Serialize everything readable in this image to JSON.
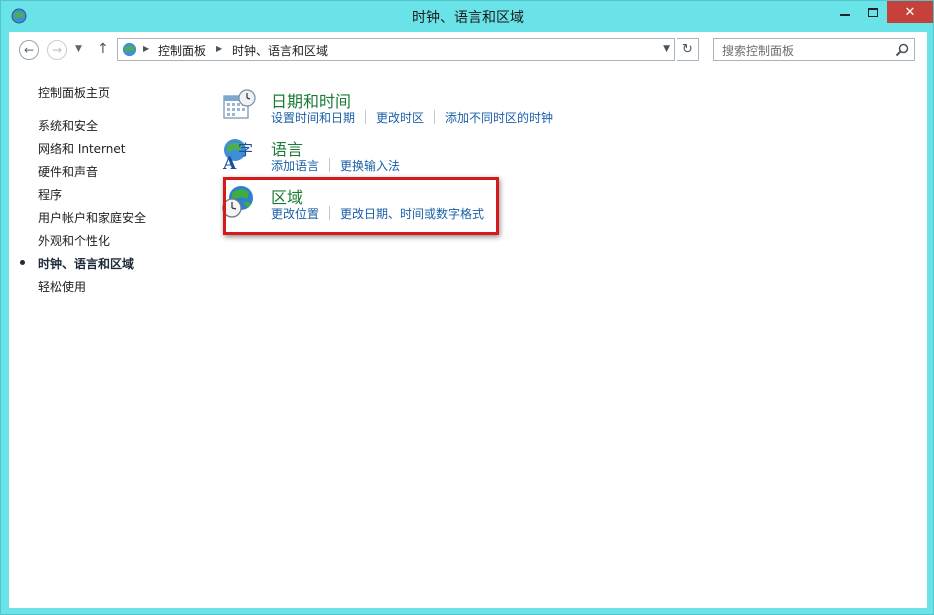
{
  "window": {
    "title": "时钟、语言和区域",
    "close_glyph": "✕"
  },
  "nav": {
    "back_glyph": "←",
    "forward_glyph": "→",
    "dropdown_glyph": "▼",
    "up_glyph": "↑",
    "refresh_glyph": "↻",
    "breadcrumb": [
      "控制面板",
      "时钟、语言和区域"
    ],
    "search_placeholder": "搜索控制面板"
  },
  "sidebar": {
    "home": "控制面板主页",
    "items": [
      {
        "label": "系统和安全",
        "active": false
      },
      {
        "label": "网络和 Internet",
        "active": false
      },
      {
        "label": "硬件和声音",
        "active": false
      },
      {
        "label": "程序",
        "active": false
      },
      {
        "label": "用户帐户和家庭安全",
        "active": false
      },
      {
        "label": "外观和个性化",
        "active": false
      },
      {
        "label": "时钟、语言和区域",
        "active": true
      },
      {
        "label": "轻松使用",
        "active": false
      }
    ]
  },
  "categories": [
    {
      "title": "日期和时间",
      "icon": "calendar-clock-icon",
      "links": [
        "设置时间和日期",
        "更改时区",
        "添加不同时区的时钟"
      ]
    },
    {
      "title": "语言",
      "icon": "language-icon",
      "links": [
        "添加语言",
        "更换输入法"
      ]
    },
    {
      "title": "区域",
      "icon": "globe-clock-icon",
      "links": [
        "更改位置",
        "更改日期、时间或数字格式"
      ],
      "highlighted": true
    }
  ],
  "colors": {
    "frame": "#6ae3e8",
    "category_title": "#1a7a36",
    "link": "#1a5fa8",
    "highlight_border": "#d41a1a",
    "close_button": "#c7413b"
  }
}
